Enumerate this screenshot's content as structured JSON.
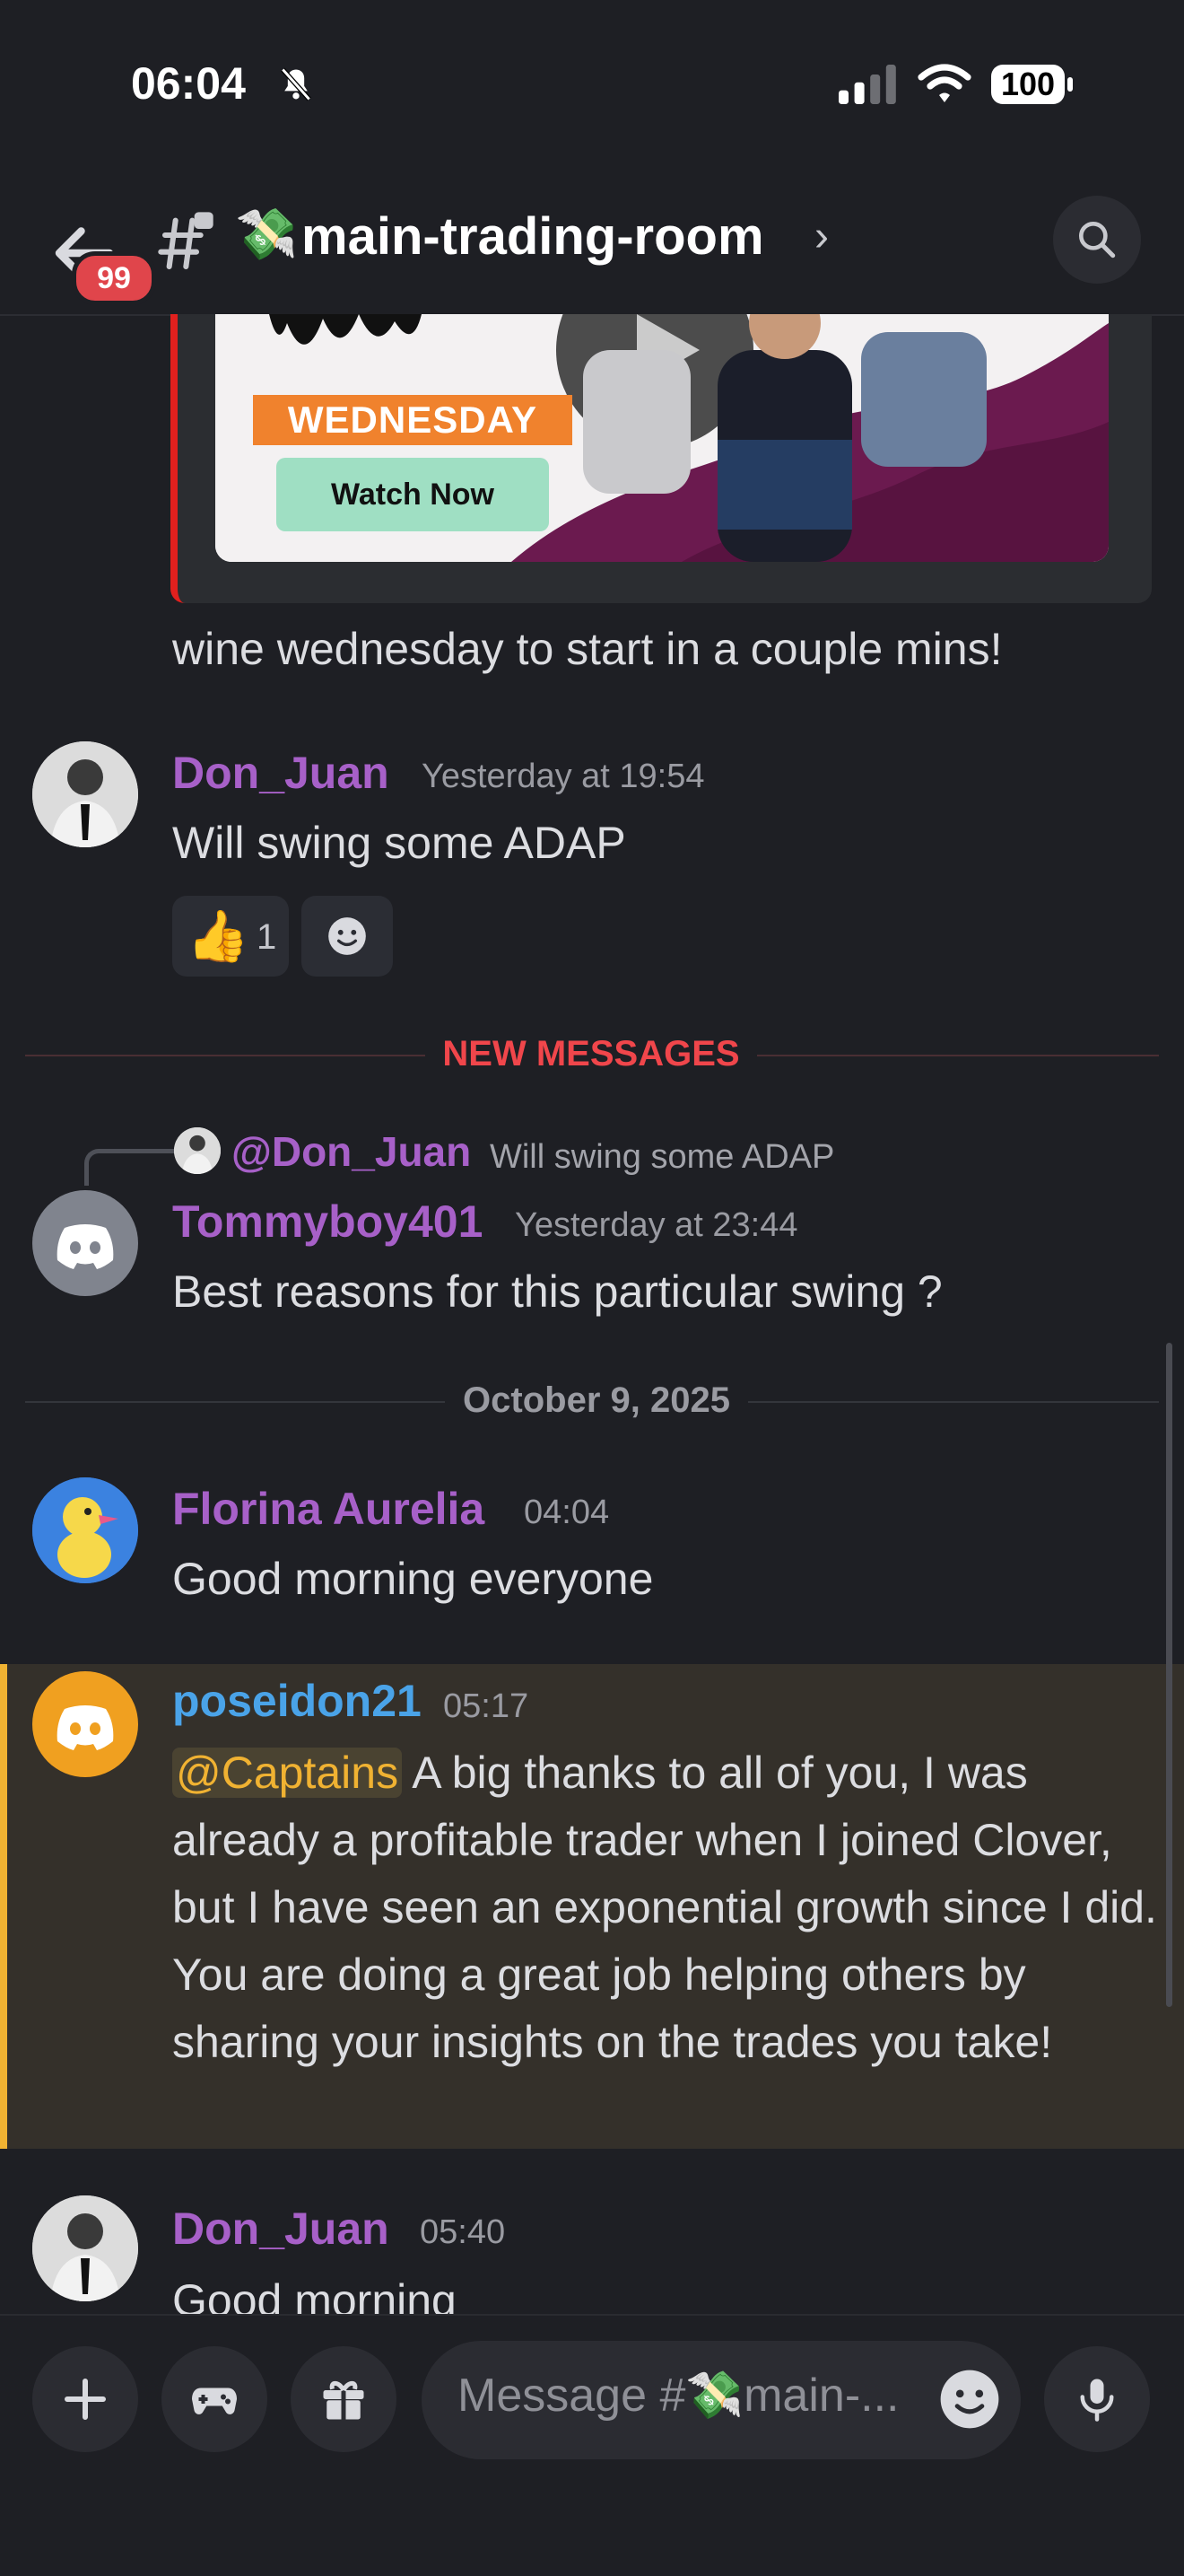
{
  "status_bar": {
    "time": "06:04",
    "battery": "100"
  },
  "header": {
    "unread_count": "99",
    "channel_emoji": "💸",
    "channel_name": "main-trading-room",
    "chevron": "›"
  },
  "embed": {
    "banner_label": "WEDNESDAY",
    "button_label": "Watch Now",
    "caption": "wine wednesday to start in a couple mins!"
  },
  "messages": [
    {
      "author": "Don_Juan",
      "time": "Yesterday at 19:54",
      "text": "Will swing some ADAP",
      "reactions": [
        {
          "emoji": "👍",
          "count": "1"
        }
      ]
    },
    {
      "reply_to": {
        "mention": "@Don_Juan",
        "text": "Will swing some ADAP"
      },
      "author": "Tommyboy401",
      "time": "Yesterday at 23:44",
      "text": "Best reasons for this particular swing ?"
    },
    {
      "author": "Florina Aurelia",
      "time": "04:04",
      "text": "Good morning everyone"
    },
    {
      "author": "poseidon21",
      "time": "05:17",
      "mention": "@Captains",
      "text": " A big thanks to all of you, I was already a profitable trader when I joined Clover, but I have seen an exponential growth since I did. You are doing a great job helping others by sharing your insights on the trades you take!"
    },
    {
      "author": "Don_Juan",
      "time": "05:40",
      "text": "Good morning"
    }
  ],
  "dividers": {
    "new_messages": "NEW MESSAGES",
    "date": "October 9, 2025"
  },
  "composer": {
    "placeholder": "Message #💸main-..."
  },
  "colors": {
    "background": "#1e1f24",
    "purple_name": "#a760c8",
    "blue_name": "#4aa3e8",
    "new_messages_red": "#f0464b",
    "mention_highlight": "#f0b232"
  }
}
